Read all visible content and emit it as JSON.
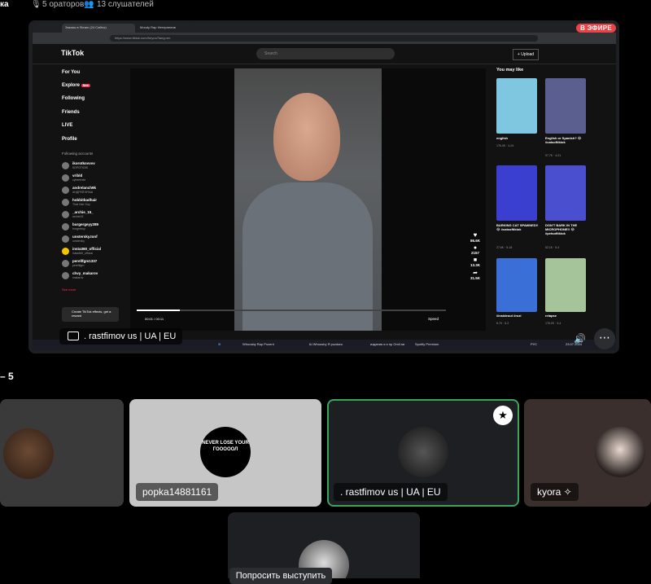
{
  "topbar": {
    "channel_fragment": "ка",
    "speakers": "5 ораторов",
    "listeners": "13 слушателей"
  },
  "stream": {
    "live_badge": "В ЭФИРЕ",
    "streamer_name": ". rastfimov us | UA | EU",
    "browser": {
      "tab1": "Заказы в Steam (24 Сайты)",
      "tab2": "Moody Rap Нетерпелив",
      "url": "https://www.tiktok.com/foryou?lang=en"
    },
    "tiktok": {
      "logo": "TikTok",
      "search_placeholder": "Search",
      "upload": "+ Upload",
      "nav": [
        "For You",
        "Explore",
        "Following",
        "Friends",
        "LIVE",
        "Profile"
      ],
      "explore_badge": "New",
      "following_accounts_label": "Following accounts",
      "accounts": [
        {
          "name": "ikorotkovvvv",
          "sub": "КОРОТКОВ"
        },
        {
          "name": "vribld",
          "sub": "cybertexte"
        },
        {
          "name": "andrelanch9k",
          "sub": "АНДРЕЙ КРАШ"
        },
        {
          "name": "hobbitbadhair",
          "sub": "That Hair Guy"
        },
        {
          "name": "_archie_15_",
          "sub": "archie15"
        },
        {
          "name": "burgergeyy289",
          "sub": "burgerboy"
        },
        {
          "name": "unstersky.tonf",
          "sub": "unstersky"
        },
        {
          "name": "insta360_official",
          "sub": "insta360_official"
        },
        {
          "name": "perellfgm1337",
          "sub": "perellfgm"
        },
        {
          "name": "chvy_makarov",
          "sub": "makarov"
        }
      ],
      "see_more": "See more",
      "create_effects": "Create TikTok effects, get a reward",
      "video_time": "00:01 / 00:11",
      "speed_label": "Speed",
      "likes": "86.6K",
      "comments": "2157",
      "saves": "13.3K",
      "shares": "31.5K",
      "you_may_like": "You may like",
      "suggestions": [
        {
          "caption": "english",
          "stats": "176.4K · 4-24",
          "color": "#7fc7e0"
        },
        {
          "caption": "English or Spanish? 😂 #catsoftiktok",
          "stats": "97.7K · 4-21",
          "color": "#5b5f8f"
        },
        {
          "caption": "BARKING CAT SPAWNED!! 😂 #catsoftiktok",
          "stats": "27.6K · 5-18",
          "color": "#3b3fcf"
        },
        {
          "caption": "DON'T BARK IN THE MICROPHONE!! 😂 #petsoftiktok",
          "stats": "52.1K · 5-4",
          "color": "#4a4fd0"
        },
        {
          "caption": "#insideout #rozi",
          "stats": "8.7K · 6-2",
          "color": "#3a6fd8"
        },
        {
          "caption": "relapse",
          "stats": "176.2K · 3-4",
          "color": "#a6c49a"
        }
      ]
    },
    "taskbar": [
      "Whoosby Rap Pozent",
      "Ш Whoosby Я pozdaro",
      "издания я и пр Оmil.rar",
      "Spotify Premium"
    ],
    "tray_lang": "РУС",
    "tray_time": "23.07.2024"
  },
  "section_label": "– 5",
  "participants": [
    {
      "name": "",
      "bg": "#3b3a3a",
      "avatar_color": "#5b3b2a"
    },
    {
      "name": "popka14881161",
      "bg": "#c6c6c6",
      "avatar_text": "NEVER LOSE YOUR ГОООООЛ"
    },
    {
      "name": ". rastfimov us | UA | EU",
      "bg": "#1e1f22",
      "avatar_color": "#2a2a2a",
      "speaking": true
    },
    {
      "name": "kyora ✧",
      "bg": "#3a2f2c",
      "avatar_color": "#2a2220"
    }
  ],
  "raise_hand": "Попросить выступить"
}
